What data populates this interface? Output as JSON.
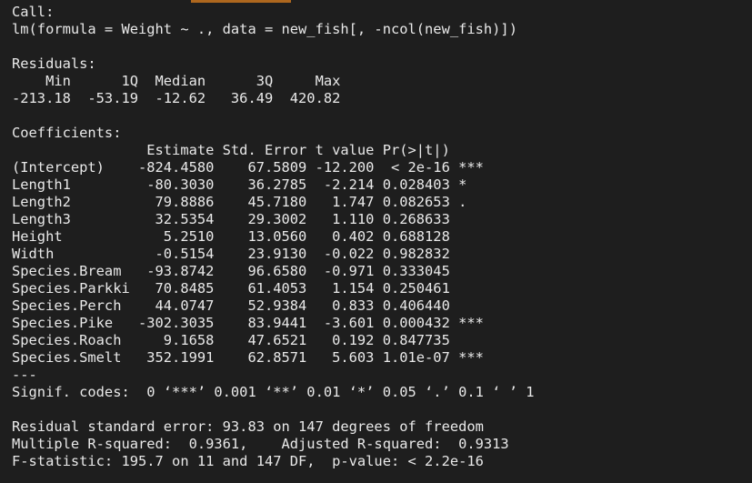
{
  "accent_color": "#c8741f",
  "call": {
    "header": "Call:",
    "formula": "lm(formula = Weight ~ ., data = new_fish[, -ncol(new_fish)])"
  },
  "residuals": {
    "header": "Residuals:",
    "labels": "    Min      1Q  Median      3Q     Max ",
    "values": "-213.18  -53.19  -12.62   36.49  420.82 "
  },
  "coefficients": {
    "header": "Coefficients:",
    "column_header": "                Estimate Std. Error t value Pr(>|t|)    ",
    "rows": [
      "(Intercept)    -824.4580    67.5809 -12.200  < 2e-16 ***",
      "Length1         -80.3030    36.2785  -2.214 0.028403 *  ",
      "Length2          79.8886    45.7180   1.747 0.082653 .  ",
      "Length3          32.5354    29.3002   1.110 0.268633    ",
      "Height            5.2510    13.0560   0.402 0.688128    ",
      "Width            -0.5154    23.9130  -0.022 0.982832    ",
      "Species.Bream   -93.8742    96.6580  -0.971 0.333045    ",
      "Species.Parkki   70.8485    61.4053   1.154 0.250461    ",
      "Species.Perch    44.0747    52.9384   0.833 0.406440    ",
      "Species.Pike   -302.3035    83.9441  -3.601 0.000432 ***",
      "Species.Roach     9.1658    47.6521   0.192 0.847735    ",
      "Species.Smelt   352.1991    62.8571   5.603 1.01e-07 ***"
    ],
    "separator": "---",
    "signif_codes": "Signif. codes:  0 ‘***’ 0.001 ‘**’ 0.01 ‘*’ 0.05 ‘.’ 0.1 ‘ ’ 1"
  },
  "summary": {
    "residual_se": "Residual standard error: 93.83 on 147 degrees of freedom",
    "r_squared": "Multiple R-squared:  0.9361,    Adjusted R-squared:  0.9313 ",
    "f_statistic": "F-statistic: 195.7 on 11 and 147 DF,  p-value: < 2.2e-16"
  }
}
